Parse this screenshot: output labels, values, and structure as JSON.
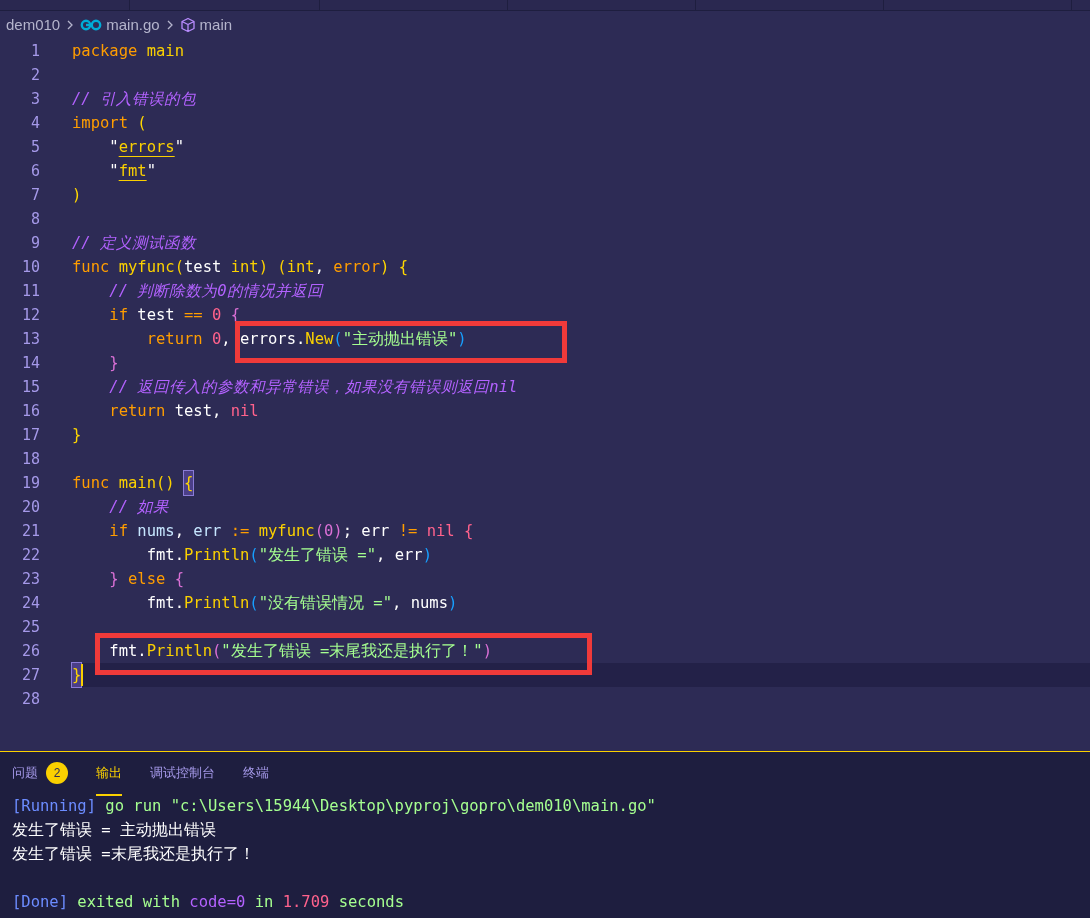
{
  "breadcrumb": [
    {
      "label": "dem010",
      "kind": "folder"
    },
    {
      "label": "main.go",
      "kind": "file"
    },
    {
      "label": "main",
      "kind": "symbol"
    }
  ],
  "editor": {
    "lines": [
      {
        "n": "1",
        "current": false,
        "tokens": [
          {
            "t": "package",
            "kind": "kw"
          },
          {
            "t": " main",
            "kind": "fn"
          }
        ]
      },
      {
        "n": "2",
        "current": false
      },
      {
        "n": "3",
        "current": false,
        "tokens": [
          {
            "t": "// 引入错误的包",
            "kind": "cmt"
          }
        ]
      },
      {
        "n": "4",
        "current": false,
        "tokens": [
          {
            "t": "import",
            "kind": "kw"
          },
          {
            "t": " (",
            "kind": "b1"
          }
        ]
      },
      {
        "n": "5",
        "current": false,
        "tokens": [
          {
            "t": "    \"",
            "kind": "plain"
          },
          {
            "t": "errors",
            "kind": "imp"
          },
          {
            "t": "\"",
            "kind": "plain"
          }
        ]
      },
      {
        "n": "6",
        "current": false,
        "tokens": [
          {
            "t": "    \"",
            "kind": "plain"
          },
          {
            "t": "fmt",
            "kind": "imp"
          },
          {
            "t": "\"",
            "kind": "plain"
          }
        ]
      },
      {
        "n": "7",
        "current": false,
        "tokens": [
          {
            "t": ")",
            "kind": "b1"
          }
        ]
      },
      {
        "n": "8",
        "current": false
      },
      {
        "n": "9",
        "current": false,
        "tokens": [
          {
            "t": "// 定义测试函数",
            "kind": "cmt"
          }
        ]
      },
      {
        "n": "10",
        "current": false,
        "tokens": [
          {
            "t": "func",
            "kind": "kw"
          },
          {
            "t": " myfunc(",
            "kind": "fn"
          },
          {
            "t": "test",
            "kind": "plain"
          },
          {
            "t": " int) (int",
            "kind": "fn"
          },
          {
            "t": ", ",
            "kind": "plain"
          },
          {
            "t": "error",
            "kind": "kw"
          },
          {
            "t": ") {",
            "kind": "b1"
          }
        ]
      },
      {
        "n": "11",
        "current": false,
        "tokens": [
          {
            "t": "    // 判断除数为0的情况并返回",
            "kind": "cmt"
          }
        ]
      },
      {
        "n": "12",
        "current": false,
        "tokens": [
          {
            "t": "    if",
            "kind": "kw"
          },
          {
            "t": " test ",
            "kind": "plain"
          },
          {
            "t": "==",
            "kind": "kw"
          },
          {
            "t": " 0 ",
            "kind": "num"
          },
          {
            "t": "{",
            "kind": "b2"
          }
        ]
      },
      {
        "n": "13",
        "current": false,
        "tokens": [
          {
            "t": "        return",
            "kind": "kw"
          },
          {
            "t": " 0",
            "kind": "num"
          },
          {
            "t": ", ",
            "kind": "plain"
          }
        ],
        "boxed_tokens": [
          {
            "t": "errors.",
            "kind": "plain"
          },
          {
            "t": "New",
            "kind": "fn"
          },
          {
            "t": "(",
            "kind": "b3"
          },
          {
            "t": "\"主动抛出错误\"",
            "kind": "str"
          },
          {
            "t": ")",
            "kind": "b3"
          }
        ]
      },
      {
        "n": "14",
        "current": false,
        "tokens": [
          {
            "t": "    }",
            "kind": "b2"
          }
        ]
      },
      {
        "n": "15",
        "current": false,
        "tokens": [
          {
            "t": "    // 返回传入的参数和异常错误，如果没有错误则返回nil",
            "kind": "cmt"
          }
        ]
      },
      {
        "n": "16",
        "current": false,
        "tokens": [
          {
            "t": "    return",
            "kind": "kw"
          },
          {
            "t": " test, ",
            "kind": "plain"
          },
          {
            "t": "nil",
            "kind": "num"
          }
        ]
      },
      {
        "n": "17",
        "current": false,
        "tokens": [
          {
            "t": "}",
            "kind": "b1"
          }
        ]
      },
      {
        "n": "18",
        "current": false
      },
      {
        "n": "19",
        "current": false,
        "tokens": [
          {
            "t": "func",
            "kind": "kw"
          },
          {
            "t": " main() ",
            "kind": "fn"
          },
          {
            "t": "{",
            "kind": "match"
          }
        ]
      },
      {
        "n": "20",
        "current": false,
        "tokens": [
          {
            "t": "    // 如果",
            "kind": "cmt"
          }
        ]
      },
      {
        "n": "21",
        "current": false,
        "tokens": [
          {
            "t": "    if",
            "kind": "kw"
          },
          {
            "t": " nums",
            "kind": "var"
          },
          {
            "t": ", ",
            "kind": "plain"
          },
          {
            "t": "err ",
            "kind": "var"
          },
          {
            "t": ":=",
            "kind": "kw"
          },
          {
            "t": " myfunc",
            "kind": "fn"
          },
          {
            "t": "(0)",
            "kind": "b2"
          },
          {
            "t": "; err ",
            "kind": "plain"
          },
          {
            "t": "!=",
            "kind": "kw"
          },
          {
            "t": " nil {",
            "kind": "num"
          }
        ]
      },
      {
        "n": "22",
        "current": false,
        "tokens": [
          {
            "t": "        fmt.",
            "kind": "plain"
          },
          {
            "t": "Println",
            "kind": "fn"
          },
          {
            "t": "(",
            "kind": "b3"
          },
          {
            "t": "\"发生了错误 =\"",
            "kind": "str"
          },
          {
            "t": ", err",
            "kind": "plain"
          },
          {
            "t": ")",
            "kind": "b3"
          }
        ]
      },
      {
        "n": "23",
        "current": false,
        "tokens": [
          {
            "t": "    }",
            "kind": "b2"
          },
          {
            "t": " else ",
            "kind": "kw"
          },
          {
            "t": "{",
            "kind": "b2"
          }
        ]
      },
      {
        "n": "24",
        "current": false,
        "tokens": [
          {
            "t": "        fmt.",
            "kind": "plain"
          },
          {
            "t": "Println",
            "kind": "fn"
          },
          {
            "t": "(",
            "kind": "b3"
          },
          {
            "t": "\"没有错误情况 =\"",
            "kind": "str"
          },
          {
            "t": ", nums",
            "kind": "plain"
          },
          {
            "t": ")",
            "kind": "b3"
          }
        ]
      },
      {
        "n": "25",
        "current": false
      },
      {
        "n": "26",
        "current": false,
        "boxed_tokens": [
          {
            "t": "    fmt.",
            "kind": "plain"
          },
          {
            "t": "Println",
            "kind": "fn"
          },
          {
            "t": "(",
            "kind": "b2"
          },
          {
            "t": "\"发生了错误 =末尾我还是执行了！\"",
            "kind": "str"
          },
          {
            "t": ")",
            "kind": "b2"
          }
        ]
      },
      {
        "n": "27",
        "current": true,
        "tokens": [
          {
            "t": "}",
            "kind": "match"
          }
        ]
      },
      {
        "n": "28",
        "current": false
      }
    ]
  },
  "panel": {
    "tabs": [
      {
        "label": "问题",
        "selected": false,
        "badge": "2"
      },
      {
        "label": "输出",
        "selected": true
      },
      {
        "label": "调试控制台",
        "selected": false
      },
      {
        "label": "终端",
        "selected": false
      }
    ],
    "output": [
      {
        "kind": "text",
        "tokens": [
          {
            "t": "[Running]",
            "kind": "tag"
          },
          {
            "t": " go run \"c:\\Users\\15944\\Desktop\\pyproj\\gopro\\dem010\\main.go\"",
            "kind": "ok"
          }
        ]
      },
      {
        "kind": "text",
        "tokens": [
          {
            "t": "发生了错误 = 主动抛出错误",
            "kind": "plain"
          }
        ]
      },
      {
        "kind": "text",
        "tokens": [
          {
            "t": "发生了错误 =末尾我还是执行了！",
            "kind": "plain"
          }
        ]
      },
      {
        "kind": "blank"
      },
      {
        "kind": "text",
        "tokens": [
          {
            "t": "[Done]",
            "kind": "tag"
          },
          {
            "t": " exited with ",
            "kind": "ok"
          },
          {
            "t": "code=0",
            "kind": "code"
          },
          {
            "t": " in ",
            "kind": "ok"
          },
          {
            "t": "1.709",
            "kind": "num"
          },
          {
            "t": " seconds",
            "kind": "ok"
          }
        ]
      }
    ]
  }
}
